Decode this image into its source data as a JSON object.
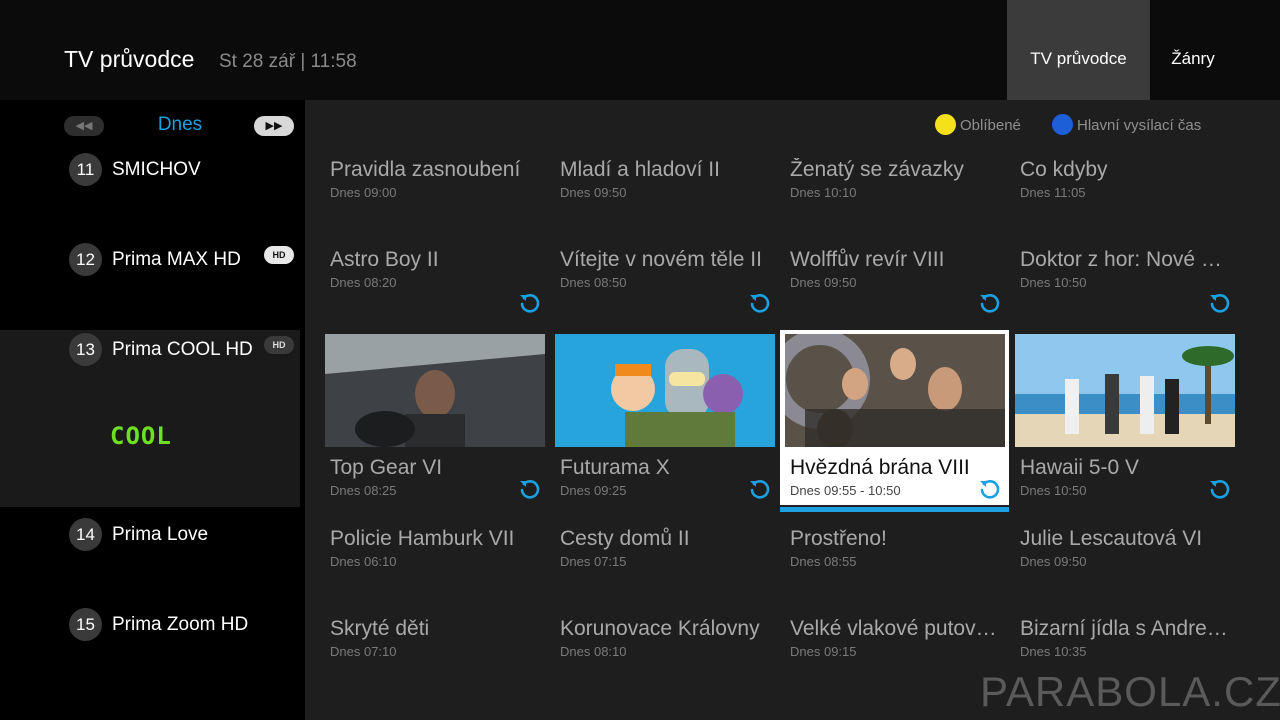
{
  "header": {
    "title": "TV průvodce",
    "datetime": "St 28 zář | 11:58",
    "tabs": [
      {
        "label": "TV průvodce",
        "active": true
      },
      {
        "label": "Žánry",
        "active": false
      }
    ]
  },
  "day_nav": {
    "prev_icon": "rewind-icon",
    "next_icon": "fast-forward-icon",
    "label": "Dnes"
  },
  "legend": [
    {
      "label": "Oblíbené",
      "color": "#f5e11a"
    },
    {
      "label": "Hlavní vysílací čas",
      "color": "#1d5fd6"
    }
  ],
  "channels": [
    {
      "number": "11",
      "name": "SMICHOV",
      "hd": false,
      "programs": [
        {
          "title": "Pravidla zasnoubení",
          "time": "Dnes 09:00",
          "replay": false
        },
        {
          "title": "Mladí a hladoví II",
          "time": "Dnes 09:50",
          "replay": false
        },
        {
          "title": "Ženatý se závazky",
          "time": "Dnes 10:10",
          "replay": false
        },
        {
          "title": "Co kdyby",
          "time": "Dnes 11:05",
          "replay": false
        }
      ]
    },
    {
      "number": "12",
      "name": "Prima MAX HD",
      "hd": true,
      "hd_label": "HD",
      "programs": [
        {
          "title": "Astro Boy II",
          "time": "Dnes 08:20",
          "replay": true
        },
        {
          "title": "Vítejte v novém těle II",
          "time": "Dnes 08:50",
          "replay": true
        },
        {
          "title": "Wolffův revír VIII",
          "time": "Dnes 09:50",
          "replay": true
        },
        {
          "title": "Doktor z hor: Nové příběhy",
          "time": "Dnes 10:50",
          "replay": true
        }
      ]
    },
    {
      "number": "13",
      "name": "Prima COOL HD",
      "hd": true,
      "hd_label": "HD",
      "logo_text": "COOL",
      "selected": true,
      "programs": [
        {
          "title": "Top Gear VI",
          "time": "Dnes 08:25",
          "replay": true,
          "thumb": "thumbnail-car-driver"
        },
        {
          "title": "Futurama X",
          "time": "Dnes 09:25",
          "replay": true,
          "thumb": "thumbnail-cartoon-characters"
        },
        {
          "title": "Hvězdná brána VIII",
          "time": "Dnes 09:55 - 10:50",
          "replay": true,
          "thumb": "thumbnail-stargate-cast",
          "focused": true
        },
        {
          "title": "Hawaii 5-0 V",
          "time": "Dnes 10:50",
          "replay": true,
          "thumb": "thumbnail-beach-cast"
        }
      ]
    },
    {
      "number": "14",
      "name": "Prima Love",
      "hd": false,
      "programs": [
        {
          "title": "Policie Hamburk VII",
          "time": "Dnes 06:10",
          "replay": false
        },
        {
          "title": "Cesty domů II",
          "time": "Dnes 07:15",
          "replay": false
        },
        {
          "title": "Prostřeno!",
          "time": "Dnes 08:55",
          "replay": false
        },
        {
          "title": "Julie Lescautová VI",
          "time": "Dnes 09:50",
          "replay": false
        }
      ]
    },
    {
      "number": "15",
      "name": "Prima Zoom HD",
      "hd": false,
      "programs": [
        {
          "title": "Skryté děti",
          "time": "Dnes 07:10",
          "replay": false
        },
        {
          "title": "Korunovace Královny",
          "time": "Dnes 08:10",
          "replay": false
        },
        {
          "title": "Velké vlakové putování",
          "time": "Dnes 09:15",
          "replay": false
        },
        {
          "title": "Bizarní jídla s Andrewem",
          "time": "Dnes 10:35",
          "replay": false
        }
      ]
    }
  ],
  "accent_color": "#1ba1e2",
  "watermark": "PARABOLA.CZ"
}
